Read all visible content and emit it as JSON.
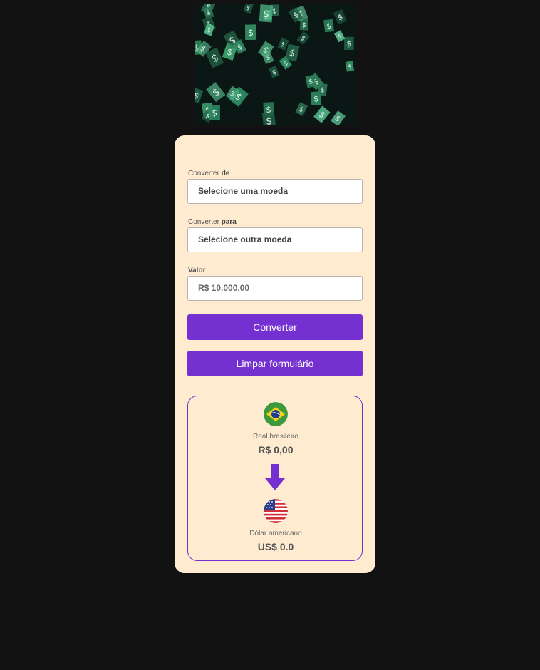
{
  "banner": {
    "icon": "money-rain-image",
    "symbol": "$",
    "accent": "#2e8b63"
  },
  "form": {
    "from_label_prefix": "Converter ",
    "from_label_bold": "de",
    "from_select_value": "Selecione uma moeda",
    "to_label_prefix": "Converter ",
    "to_label_bold": "para",
    "to_select_value": "Selecione outra moeda",
    "amount_label": "Valor",
    "amount_value": "R$ 10.000,00",
    "convert_button": "Converter",
    "clear_button": "Limpar formulário"
  },
  "result": {
    "from_flag_icon": "brazil-flag-icon",
    "from_currency_name": "Real brasileiro",
    "from_currency_value": "R$ 0,00",
    "arrow_icon": "arrow-down-icon",
    "to_flag_icon": "usa-flag-icon",
    "to_currency_name": "Dólar americano",
    "to_currency_value": "US$ 0.0"
  },
  "colors": {
    "background": "#121212",
    "card": "#ffecd0",
    "accent": "#7430d1"
  }
}
